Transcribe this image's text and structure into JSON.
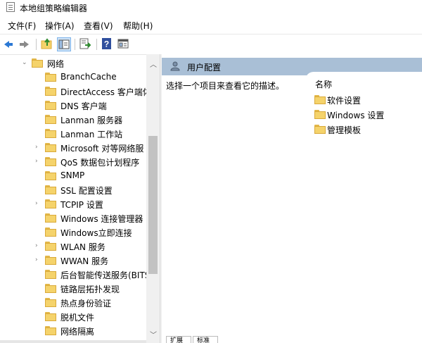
{
  "window": {
    "title": "本地组策略编辑器"
  },
  "menu": [
    "文件(F)",
    "操作(A)",
    "查看(V)",
    "帮助(H)"
  ],
  "toolbar": {
    "back_icon": "arrow-left-icon",
    "forward_icon": "arrow-right-icon",
    "up_icon": "folder-up-icon",
    "showhide_icon": "console-tree-icon",
    "export_icon": "export-list-icon",
    "help_icon": "help-icon",
    "view_icon": "properties-icon"
  },
  "tree": {
    "root": "网络",
    "items": [
      {
        "label": "BranchCache",
        "expandable": false
      },
      {
        "label": "DirectAccess 客户端体",
        "expandable": false
      },
      {
        "label": "DNS 客户端",
        "expandable": false
      },
      {
        "label": "Lanman 服务器",
        "expandable": false
      },
      {
        "label": "Lanman 工作站",
        "expandable": false
      },
      {
        "label": "Microsoft 对等网络服",
        "expandable": true
      },
      {
        "label": "QoS 数据包计划程序",
        "expandable": true
      },
      {
        "label": "SNMP",
        "expandable": false
      },
      {
        "label": "SSL 配置设置",
        "expandable": false
      },
      {
        "label": "TCPIP 设置",
        "expandable": true
      },
      {
        "label": "Windows 连接管理器",
        "expandable": false
      },
      {
        "label": "Windows立即连接",
        "expandable": false
      },
      {
        "label": "WLAN 服务",
        "expandable": true
      },
      {
        "label": "WWAN 服务",
        "expandable": true
      },
      {
        "label": "后台智能传送服务(BITS",
        "expandable": false
      },
      {
        "label": "链路层拓扑发现",
        "expandable": false
      },
      {
        "label": "热点身份验证",
        "expandable": false
      },
      {
        "label": "脱机文件",
        "expandable": false
      },
      {
        "label": "网络隔离",
        "expandable": false
      }
    ]
  },
  "right_pane": {
    "title": "用户配置",
    "description": "选择一个项目来查看它的描述。",
    "column": "名称",
    "items": [
      "软件设置",
      "Windows 设置",
      "管理模板"
    ]
  },
  "tabs": [
    "扩展",
    "标准"
  ],
  "colors": {
    "header": "#a9bfd6",
    "folder": "#f5d36b",
    "accent": "#2b78d4"
  }
}
